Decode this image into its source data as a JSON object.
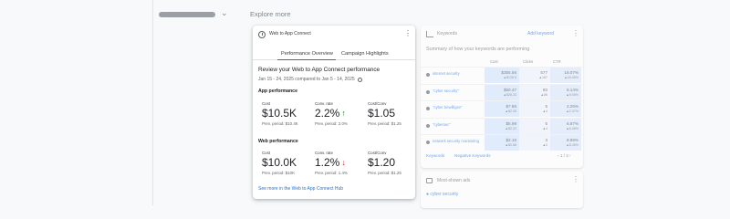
{
  "nav": {
    "explore_label": "Explore more"
  },
  "card": {
    "title": "Web to App Connect",
    "tabs": [
      {
        "label": "Performance Overview",
        "selected": true
      },
      {
        "label": "Campaign Highlights",
        "selected": false
      }
    ],
    "review_title": "Review your Web to App Connect performance",
    "date_range": "Jan 15 - 24, 2025 compared to Jan 5 - 14, 2025",
    "app_section": {
      "label": "App performance",
      "metrics": [
        {
          "label": "Cost",
          "value": "$10.5K",
          "prev": "Prev. period: $10.4K",
          "trend": ""
        },
        {
          "label": "Conv. rate",
          "value": "2.2%",
          "prev": "Prev. period: 2.0%",
          "trend": "up"
        },
        {
          "label": "Cost/Conv",
          "value": "$1.05",
          "prev": "Prev. period: $1.25",
          "trend": ""
        }
      ]
    },
    "web_section": {
      "label": "Web performance",
      "metrics": [
        {
          "label": "Cost",
          "value": "$10.0K",
          "prev": "Prev. period: $10K",
          "trend": ""
        },
        {
          "label": "Conv. rate",
          "value": "1.2%",
          "prev": "Prev. period: 1.4%",
          "trend": "down"
        },
        {
          "label": "Cost/Conv",
          "value": "$1.20",
          "prev": "Prev. period: $1.25",
          "trend": ""
        }
      ]
    },
    "hub_link": "See more in the Web to App Connect Hub"
  },
  "keywords_card": {
    "title": "Keywords",
    "add_label": "Add keyword",
    "summary": "Summary of how your keywords are performing",
    "columns": [
      "Cost",
      "Clicks",
      "CTR"
    ],
    "rows": [
      {
        "keyword": "internet security",
        "cost": "$355.56",
        "cost_change": "▲$135.5",
        "clicks": "577",
        "clicks_change": "▲167",
        "ctr": "18.07%",
        "ctr_change": "▲18.45%"
      },
      {
        "keyword": "\"cyber security\"",
        "cost": "$50.47",
        "cost_change": "▲$28.33",
        "clicks": "93",
        "clicks_change": "▲86",
        "ctr": "6.14%",
        "ctr_change": "▲6.06%"
      },
      {
        "keyword": "\"cyber bewilligen\"",
        "cost": "$7.86",
        "cost_change": "▲$2.35",
        "clicks": "5",
        "clicks_change": "▲4",
        "ctr": "2.26%",
        "ctr_change": "▲2.47%"
      },
      {
        "keyword": "\"cybersec\"",
        "cost": "$5.99",
        "cost_change": "▲$2.22",
        "clicks": "5",
        "clicks_change": "▲4",
        "ctr": "6.67%",
        "ctr_change": "▲6.48%"
      },
      {
        "keyword": "network security monitoring",
        "cost": "$2.16",
        "cost_change": "▲$0.88",
        "clicks": "3",
        "clicks_change": "▲0",
        "ctr": "8.89%",
        "ctr_change": "▲8.45%"
      }
    ],
    "footer": [
      "Keywords",
      "Negative Keywords"
    ],
    "pager": "1 / 3"
  },
  "search_card": {
    "title": "Most-shown ads",
    "link": "cyber security"
  }
}
